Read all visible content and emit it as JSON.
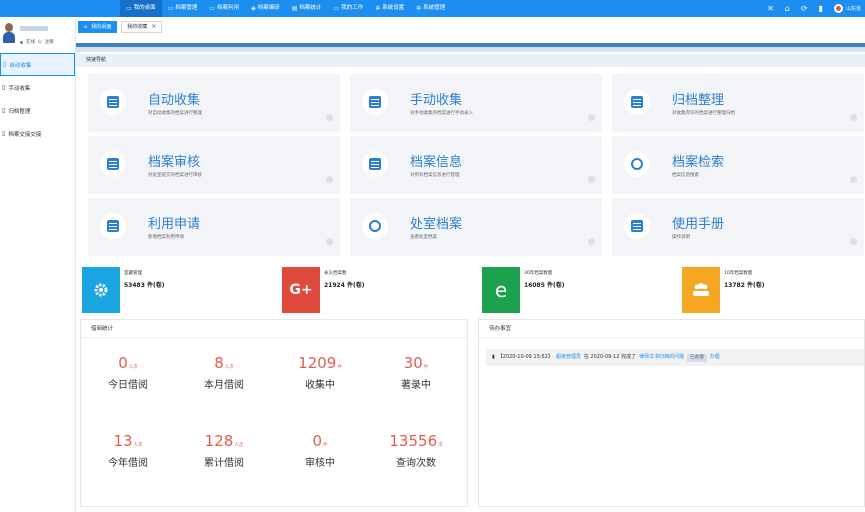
{
  "topbar": {
    "nav": [
      {
        "label": "我的桌面",
        "icon": "monitor-icon",
        "active": true
      },
      {
        "label": "档案管理",
        "icon": "folder-icon",
        "active": false
      },
      {
        "label": "档案利用",
        "icon": "folder-icon",
        "active": false
      },
      {
        "label": "档案编研",
        "icon": "book-icon",
        "active": false
      },
      {
        "label": "档案统计",
        "icon": "chart-icon",
        "active": false
      },
      {
        "label": "我的工作",
        "icon": "briefcase-icon",
        "active": false
      },
      {
        "label": "系统设置",
        "icon": "gear-icon",
        "active": false
      },
      {
        "label": "系统管理",
        "icon": "gear-icon",
        "active": false
      }
    ],
    "user_label": "山东省"
  },
  "sidebar": {
    "status_online": "在线",
    "status_exit": "注销",
    "items": [
      {
        "label": "自动收集",
        "active": true
      },
      {
        "label": "手动收集",
        "active": false
      },
      {
        "label": "归档整理",
        "active": false
      },
      {
        "label": "档案交接交接",
        "active": false
      }
    ]
  },
  "tabs": [
    {
      "label": "我的桌面",
      "active": true
    },
    {
      "label": "我的收藏",
      "active": false
    }
  ],
  "quick_nav": {
    "title": "快速导航",
    "cards": [
      {
        "title": "自动收集",
        "desc": "对自动收集的档案进行整理",
        "icon": "inbox-icon"
      },
      {
        "title": "手动收集",
        "desc": "对手动收集的档案进行手动录入",
        "icon": "upload-icon"
      },
      {
        "title": "归档整理",
        "desc": "对收集完毕的档案进行整理归档",
        "icon": "archive-box-icon"
      },
      {
        "title": "档案审核",
        "desc": "对处室提交的档案进行审核",
        "icon": "audit-icon"
      },
      {
        "title": "档案信息",
        "desc": "对所有档案信息进行管理",
        "icon": "document-icon"
      },
      {
        "title": "档案检索",
        "desc": "档案信息搜索",
        "icon": "search-icon"
      },
      {
        "title": "利用申请",
        "desc": "新增档案利用申请",
        "icon": "request-icon"
      },
      {
        "title": "处室档案",
        "desc": "查看处室档案",
        "icon": "layers-icon"
      },
      {
        "title": "使用手册",
        "desc": "操作说明",
        "icon": "manual-icon"
      }
    ]
  },
  "stats": [
    {
      "label": "室藏管理",
      "value": "53483 件(卷)",
      "color": "#1aa5e0",
      "icon": "gear-icon"
    },
    {
      "label": "永久档案数",
      "value": "21924 件(卷)",
      "color": "#e04a3c",
      "icon": "google-plus-icon"
    },
    {
      "label": "30年档案数量",
      "value": "16085 件(卷)",
      "color": "#1ca14e",
      "icon": "ie-icon"
    },
    {
      "label": "10年档案数量",
      "value": "13782 件(卷)",
      "color": "#f5a623",
      "icon": "users-icon"
    }
  ],
  "borrow_stats": {
    "title": "借阅统计",
    "items": [
      {
        "value": "0",
        "unit": "人次",
        "label": "今日借阅"
      },
      {
        "value": "8",
        "unit": "人次",
        "label": "本月借阅"
      },
      {
        "value": "1209",
        "unit": "件",
        "label": "收集中"
      },
      {
        "value": "30",
        "unit": "件",
        "label": "著录中"
      },
      {
        "value": "13",
        "unit": "人次",
        "label": "今年借阅"
      },
      {
        "value": "128",
        "unit": "人次",
        "label": "累计借阅"
      },
      {
        "value": "0",
        "unit": "件",
        "label": "审核中"
      },
      {
        "value": "13556",
        "unit": "次",
        "label": "查询次数"
      }
    ]
  },
  "todo": {
    "title": "待办事宜",
    "items": [
      {
        "prefix": "【2020-10-09 15:52】",
        "user": "超级管理员",
        "mid": "在 2020-09-12 完成了",
        "subject": "律师文书归档的问题",
        "tag": "已办理",
        "link": "办理"
      }
    ]
  }
}
